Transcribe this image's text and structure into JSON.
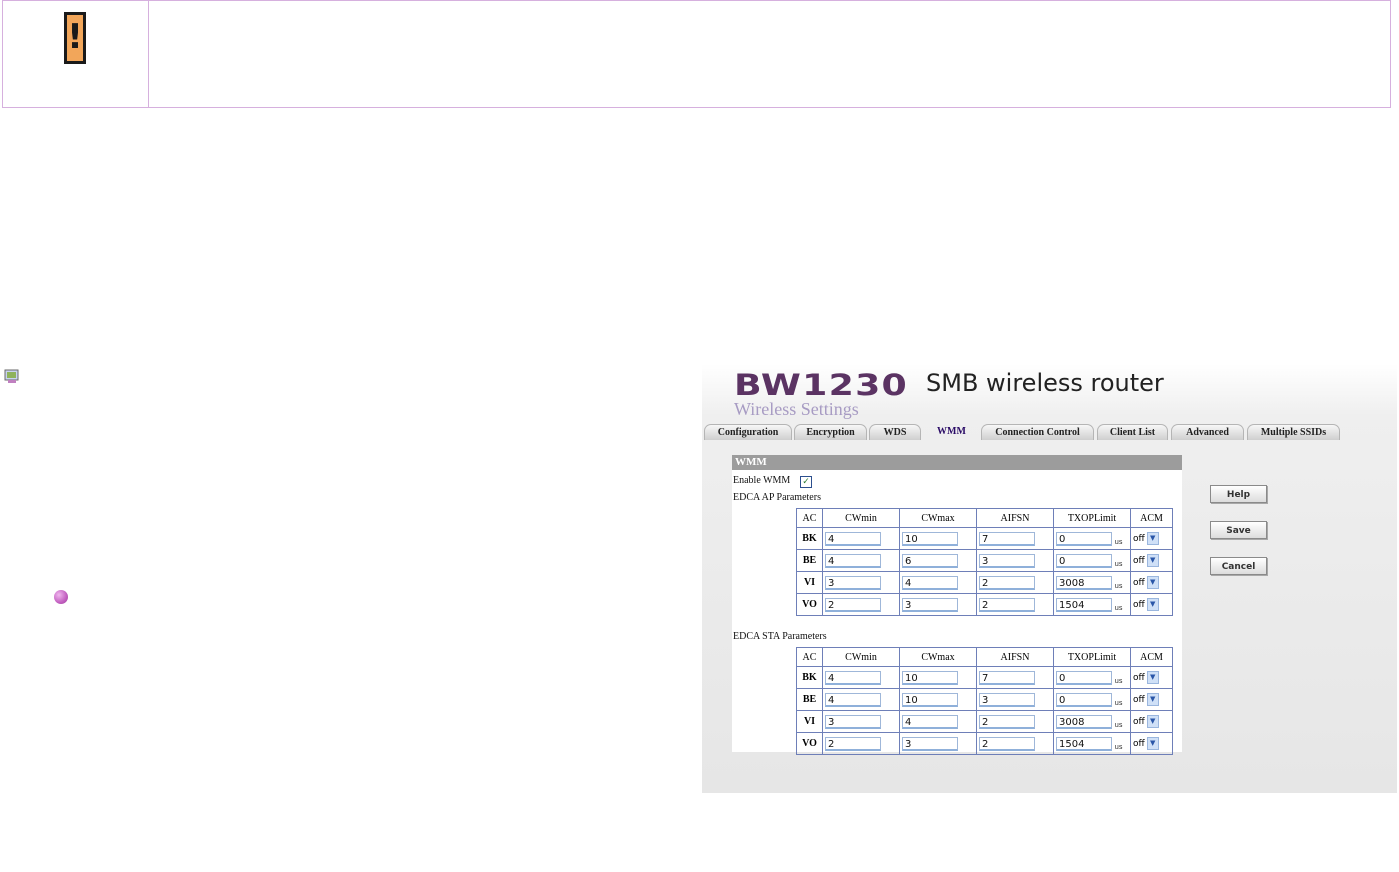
{
  "warning": {
    "icon": "exclamation-icon",
    "glyph": "!",
    "icon_color": "#f2a65a"
  },
  "note_icon": "computer-icon",
  "bullet_color": "#c25fc0",
  "router_ui": {
    "brand": "BW1230",
    "brand_subtitle": "SMB wireless router",
    "page_title": "Wireless Settings",
    "tabs": [
      "Configuration",
      "Encryption",
      "WDS",
      "WMM",
      "Connection Control",
      "Client List",
      "Advanced",
      "Multiple SSIDs"
    ],
    "active_tab": "WMM",
    "section_title": "WMM",
    "enable_wmm_label": "Enable WMM",
    "enable_wmm_checked": true,
    "ap_params_label": "EDCA AP Parameters",
    "sta_params_label": "EDCA STA Parameters",
    "columns": [
      "AC",
      "CWmin",
      "CWmax",
      "AIFSN",
      "TXOPLimit",
      "ACM"
    ],
    "unit_label": "us",
    "ap_rows": [
      {
        "ac": "BK",
        "cwmin": "4",
        "cwmax": "10",
        "aifsn": "7",
        "txop": "0",
        "acm": "off"
      },
      {
        "ac": "BE",
        "cwmin": "4",
        "cwmax": "6",
        "aifsn": "3",
        "txop": "0",
        "acm": "off"
      },
      {
        "ac": "VI",
        "cwmin": "3",
        "cwmax": "4",
        "aifsn": "2",
        "txop": "3008",
        "acm": "off"
      },
      {
        "ac": "VO",
        "cwmin": "2",
        "cwmax": "3",
        "aifsn": "2",
        "txop": "1504",
        "acm": "off"
      }
    ],
    "sta_rows": [
      {
        "ac": "BK",
        "cwmin": "4",
        "cwmax": "10",
        "aifsn": "7",
        "txop": "0",
        "acm": "off"
      },
      {
        "ac": "BE",
        "cwmin": "4",
        "cwmax": "10",
        "aifsn": "3",
        "txop": "0",
        "acm": "off"
      },
      {
        "ac": "VI",
        "cwmin": "3",
        "cwmax": "4",
        "aifsn": "2",
        "txop": "3008",
        "acm": "off"
      },
      {
        "ac": "VO",
        "cwmin": "2",
        "cwmax": "3",
        "aifsn": "2",
        "txop": "1504",
        "acm": "off"
      }
    ],
    "buttons": {
      "help": "Help",
      "save": "Save",
      "cancel": "Cancel"
    },
    "colors": {
      "brand": "#5b3363",
      "page_title": "#a79bc3",
      "panel_header": "#9c9c9c",
      "active_tab": "#2a0b66"
    }
  }
}
